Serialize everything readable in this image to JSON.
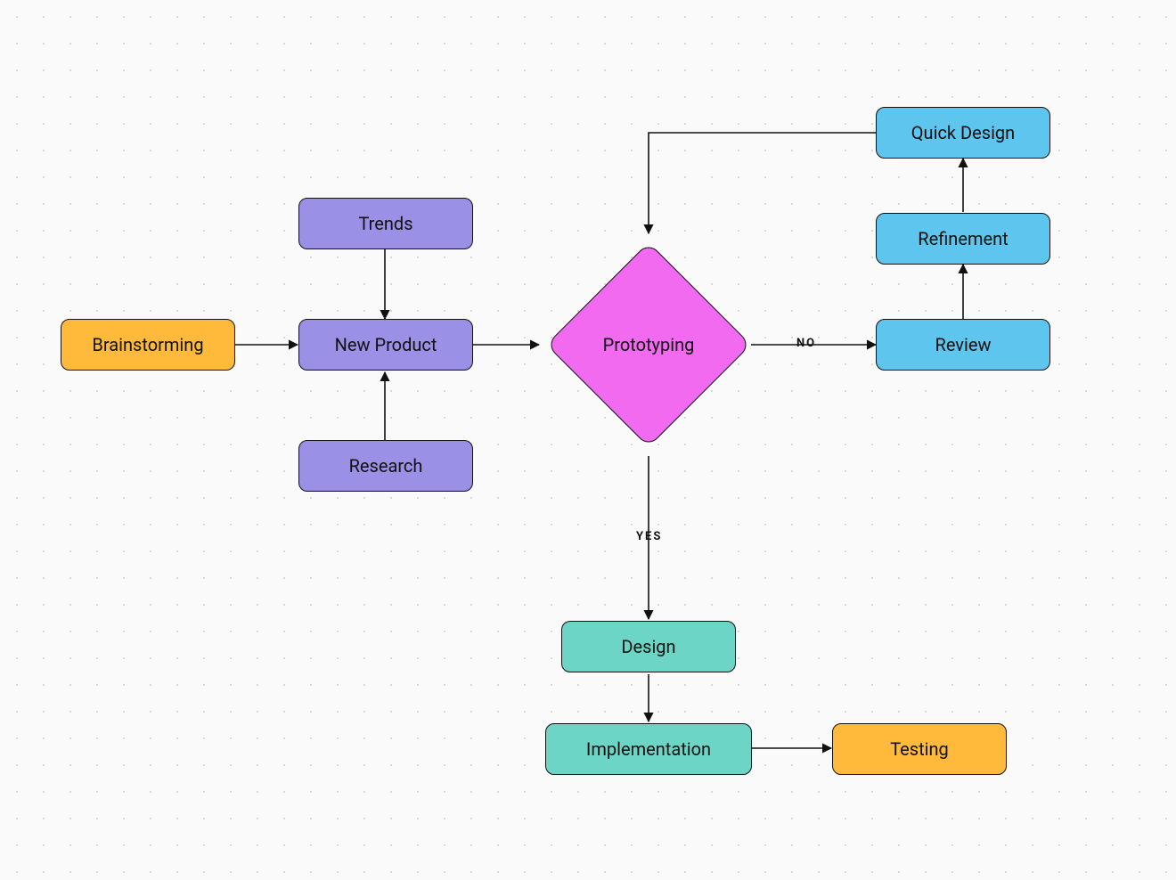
{
  "nodes": {
    "brainstorming": {
      "label": "Brainstorming",
      "color": "orange"
    },
    "trends": {
      "label": "Trends",
      "color": "purple"
    },
    "newProduct": {
      "label": "New Product",
      "color": "purple"
    },
    "research": {
      "label": "Research",
      "color": "purple"
    },
    "prototyping": {
      "label": "Prototyping",
      "color": "magenta",
      "shape": "diamond"
    },
    "quickDesign": {
      "label": "Quick Design",
      "color": "cyan"
    },
    "refinement": {
      "label": "Refinement",
      "color": "cyan"
    },
    "review": {
      "label": "Review",
      "color": "cyan"
    },
    "design": {
      "label": "Design",
      "color": "teal"
    },
    "implementation": {
      "label": "Implementation",
      "color": "teal"
    },
    "testing": {
      "label": "Testing",
      "color": "orange"
    }
  },
  "edges": [
    {
      "from": "brainstorming",
      "to": "newProduct"
    },
    {
      "from": "trends",
      "to": "newProduct"
    },
    {
      "from": "research",
      "to": "newProduct"
    },
    {
      "from": "newProduct",
      "to": "prototyping"
    },
    {
      "from": "prototyping",
      "to": "review",
      "label": "NO"
    },
    {
      "from": "review",
      "to": "refinement"
    },
    {
      "from": "refinement",
      "to": "quickDesign"
    },
    {
      "from": "quickDesign",
      "to": "prototyping"
    },
    {
      "from": "prototyping",
      "to": "design",
      "label": "YES"
    },
    {
      "from": "design",
      "to": "implementation"
    },
    {
      "from": "implementation",
      "to": "testing"
    }
  ],
  "edgeLabels": {
    "no": "NO",
    "yes": "YES"
  }
}
